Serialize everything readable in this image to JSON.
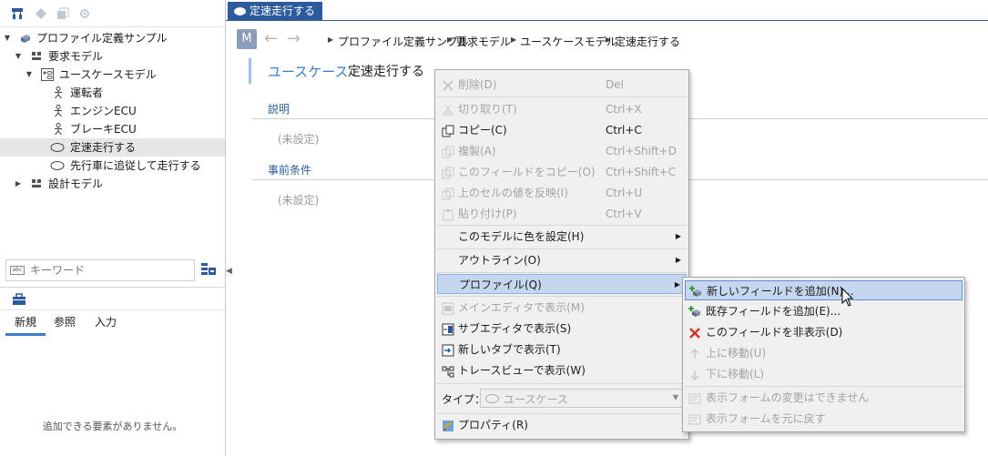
{
  "left_panel": {
    "toolbar": [
      "hierarchy-icon",
      "tag-icon",
      "stack-icon",
      "settings-icon"
    ],
    "tree": [
      {
        "label": "プロファイル定義サンプル",
        "level": 0,
        "expanded": true,
        "icon": "profile-icon"
      },
      {
        "label": "要求モデル",
        "level": 1,
        "expanded": true,
        "icon": "model-icon"
      },
      {
        "label": "ユースケースモデル",
        "level": 2,
        "expanded": true,
        "icon": "usecase-model-icon"
      },
      {
        "label": "運転者",
        "level": 3,
        "icon": "actor-icon"
      },
      {
        "label": "エンジンECU",
        "level": 3,
        "icon": "actor-icon"
      },
      {
        "label": "ブレーキECU",
        "level": 3,
        "icon": "actor-icon"
      },
      {
        "label": "定速走行する",
        "level": 3,
        "icon": "usecase-icon",
        "selected": true
      },
      {
        "label": "先行車に追従して走行する",
        "level": 3,
        "icon": "usecase-icon"
      },
      {
        "label": "設計モデル",
        "level": 1,
        "expanded": false,
        "icon": "model-icon"
      }
    ],
    "search": {
      "placeholder": "キーワード"
    },
    "palette_tabs": [
      "新規",
      "参照",
      "入力"
    ],
    "palette_empty": "追加できる要素がありません。"
  },
  "editor": {
    "tab_title": "定速走行する",
    "nav_badge": "M",
    "breadcrumb": [
      "プロファイル定義サンプル",
      "要求モデル",
      "ユースケースモデル",
      "定速走行する"
    ],
    "title_kind": "ユースケース",
    "title_name": "定速走行する",
    "sections": [
      {
        "label": "説明",
        "value": "(未設定)"
      },
      {
        "label": "事前条件",
        "value": "(未設定)"
      }
    ]
  },
  "context_menu": {
    "items": [
      {
        "label": "削除(D)",
        "shortcut": "Del",
        "enabled": false,
        "icon": "delete-icon"
      },
      {
        "label": "切り取り(T)",
        "shortcut": "Ctrl+X",
        "enabled": false,
        "icon": "cut-icon"
      },
      {
        "label": "コピー(C)",
        "shortcut": "Ctrl+C",
        "enabled": true,
        "icon": "copy-icon"
      },
      {
        "label": "複製(A)",
        "shortcut": "Ctrl+Shift+D",
        "enabled": false,
        "icon": "duplicate-icon"
      },
      {
        "label": "このフィールドをコピー(O)",
        "shortcut": "Ctrl+Shift+C",
        "enabled": false,
        "icon": "copy-field-icon"
      },
      {
        "label": "上のセルの値を反映(I)",
        "shortcut": "Ctrl+U",
        "enabled": false,
        "icon": "fill-up-icon"
      },
      {
        "label": "貼り付け(P)",
        "shortcut": "Ctrl+V",
        "enabled": false,
        "icon": "paste-icon"
      },
      {
        "label": "このモデルに色を設定(H)",
        "submenu": true,
        "enabled": true
      },
      {
        "label": "アウトライン(O)",
        "submenu": true,
        "enabled": true
      },
      {
        "label": "プロファイル(Q)",
        "submenu": true,
        "enabled": true,
        "highlighted": true
      },
      {
        "label": "メインエディタで表示(M)",
        "enabled": false,
        "icon": "main-editor-icon"
      },
      {
        "label": "サブエディタで表示(S)",
        "enabled": true,
        "icon": "sub-editor-icon"
      },
      {
        "label": "新しいタブで表示(T)",
        "enabled": true,
        "icon": "new-tab-icon"
      },
      {
        "label": "トレースビューで表示(W)",
        "enabled": true,
        "icon": "trace-view-icon"
      },
      {
        "label": "プロパティ(R)",
        "enabled": true,
        "icon": "properties-icon"
      }
    ],
    "type_label": "タイプ：",
    "type_value": "ユースケース"
  },
  "profile_submenu": {
    "items": [
      {
        "label": "新しいフィールドを追加(N)...",
        "enabled": true,
        "highlighted": true,
        "icon": "add-new-field-icon"
      },
      {
        "label": "既存フィールドを追加(E)...",
        "enabled": true,
        "icon": "add-existing-field-icon"
      },
      {
        "label": "このフィールドを非表示(D)",
        "enabled": true,
        "icon": "hide-field-icon"
      },
      {
        "label": "上に移動(U)",
        "enabled": false,
        "icon": "arrow-up-icon"
      },
      {
        "label": "下に移動(L)",
        "enabled": false,
        "icon": "arrow-down-icon"
      },
      {
        "label": "表示フォームの変更はできません",
        "enabled": false,
        "icon": "form-icon"
      },
      {
        "label": "表示フォームを元に戻す",
        "enabled": false,
        "icon": "form-icon"
      }
    ]
  },
  "colors": {
    "accent": "#2c5a9a",
    "link": "#3d7cc9",
    "menu_highlight": "#c5d6ef",
    "delete_red": "#d93025"
  }
}
